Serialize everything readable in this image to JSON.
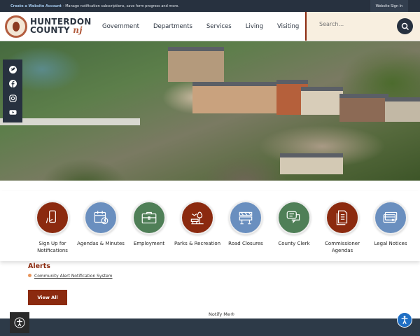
{
  "topbar": {
    "account_link": "Create a Website Account",
    "account_desc": "- Manage notification subscriptions, save form progress and more.",
    "sign_in": "Website Sign In"
  },
  "logo": {
    "line1": "HUNTERDON",
    "line2": "COUNTY",
    "nj": "nj"
  },
  "nav": [
    "Government",
    "Departments",
    "Services",
    "Living",
    "Visiting"
  ],
  "search": {
    "placeholder": "Search..."
  },
  "social": [
    "twitter-icon",
    "facebook-icon",
    "instagram-icon",
    "youtube-icon"
  ],
  "tiles": [
    {
      "label": "Sign Up for Notifications",
      "color": "#8b2a0f"
    },
    {
      "label": "Agendas & Minutes",
      "color": "#6a8fbf"
    },
    {
      "label": "Employment",
      "color": "#4f7f57"
    },
    {
      "label": "Parks & Recreation",
      "color": "#8b2a0f"
    },
    {
      "label": "Road Closures",
      "color": "#6a8fbf"
    },
    {
      "label": "County Clerk",
      "color": "#4f7f57"
    },
    {
      "label": "Commissioner Agendas",
      "color": "#8b2a0f"
    },
    {
      "label": "Legal Notices",
      "color": "#6a8fbf"
    }
  ],
  "alerts": {
    "title": "Alerts",
    "item": "Community Alert Notification System",
    "view_all": "View All",
    "notify": "Notify Me®"
  }
}
